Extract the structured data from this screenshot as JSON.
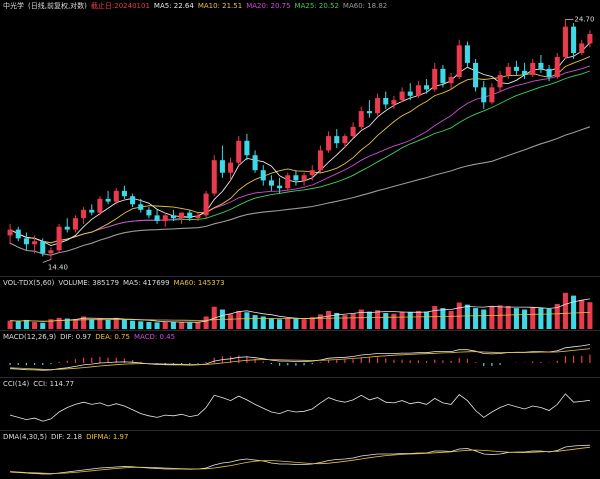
{
  "header": {
    "name": "中光学",
    "period": "(日线,前复权,对数)",
    "date_label": "截止日:20240101",
    "ma5": "MA5: 22.64",
    "ma10": "MA10: 21.51",
    "ma20": "MA20: 20.75",
    "ma25": "MA25: 20.52",
    "ma60": "MA60: 18.82"
  },
  "price_labels": {
    "high": "24.70",
    "low": "14.40"
  },
  "volume": {
    "title": "VOL-TDX(5,60)",
    "volume": "VOLUME: 385179",
    "ma5": "MA5: 417699",
    "ma60": "MA60: 145373"
  },
  "macd": {
    "title": "MACD(12,26,9)",
    "dif": "DIF: 0.97",
    "dea": "DEA: 0.75",
    "macd": "MACD: 0.45"
  },
  "cci": {
    "title": "CCI(14)",
    "cci": "CCI: 114.77"
  },
  "dma": {
    "title": "DMA(4,30,5)",
    "dif": "DIF: 2.18",
    "difma": "DIFMA: 1.97"
  },
  "colors": {
    "up": "#e83b4e",
    "down": "#3fd8e6",
    "ma5": "#e8e8e8",
    "ma10": "#e8c13a",
    "ma20": "#d04cd8",
    "ma25": "#3bd15a",
    "ma60": "#9a9a9a"
  },
  "chart_data": {
    "type": "candlestick",
    "ohlc": [
      [
        15.2,
        15.6,
        14.9,
        15.4
      ],
      [
        15.4,
        15.5,
        15.0,
        15.1
      ],
      [
        15.1,
        15.3,
        14.7,
        14.9
      ],
      [
        14.9,
        15.2,
        14.6,
        15.0
      ],
      [
        15.0,
        15.1,
        14.5,
        14.6
      ],
      [
        14.6,
        14.8,
        14.4,
        14.7
      ],
      [
        14.7,
        15.6,
        14.6,
        15.5
      ],
      [
        15.5,
        15.8,
        15.3,
        15.4
      ],
      [
        15.4,
        15.9,
        15.3,
        15.8
      ],
      [
        15.8,
        16.2,
        15.6,
        16.1
      ],
      [
        16.1,
        16.3,
        15.9,
        16.0
      ],
      [
        16.0,
        16.6,
        15.9,
        16.5
      ],
      [
        16.5,
        16.8,
        16.3,
        16.4
      ],
      [
        16.4,
        16.9,
        16.3,
        16.8
      ],
      [
        16.8,
        17.0,
        16.5,
        16.6
      ],
      [
        16.6,
        16.7,
        16.2,
        16.3
      ],
      [
        16.3,
        16.5,
        16.0,
        16.1
      ],
      [
        16.1,
        16.2,
        15.8,
        15.9
      ],
      [
        15.9,
        16.1,
        15.6,
        15.7
      ],
      [
        15.7,
        16.0,
        15.5,
        15.9
      ],
      [
        15.9,
        16.1,
        15.7,
        15.8
      ],
      [
        15.8,
        16.0,
        15.6,
        16.0
      ],
      [
        16.0,
        16.1,
        15.7,
        15.8
      ],
      [
        15.8,
        16.0,
        15.7,
        15.9
      ],
      [
        15.9,
        16.8,
        15.8,
        16.7
      ],
      [
        16.7,
        18.2,
        16.6,
        18.0
      ],
      [
        18.0,
        18.6,
        17.3,
        17.5
      ],
      [
        17.5,
        18.1,
        17.2,
        17.9
      ],
      [
        17.9,
        19.0,
        17.8,
        18.8
      ],
      [
        18.8,
        19.1,
        18.0,
        18.2
      ],
      [
        18.2,
        18.4,
        17.5,
        17.6
      ],
      [
        17.6,
        17.8,
        17.0,
        17.2
      ],
      [
        17.2,
        17.4,
        16.8,
        17.0
      ],
      [
        17.0,
        17.3,
        16.7,
        16.9
      ],
      [
        16.9,
        17.5,
        16.8,
        17.4
      ],
      [
        17.4,
        17.6,
        17.0,
        17.2
      ],
      [
        17.2,
        17.5,
        17.0,
        17.4
      ],
      [
        17.4,
        17.8,
        17.2,
        17.6
      ],
      [
        17.6,
        18.6,
        17.5,
        18.4
      ],
      [
        18.4,
        19.2,
        18.3,
        19.0
      ],
      [
        19.0,
        19.3,
        18.5,
        18.7
      ],
      [
        18.7,
        19.1,
        18.5,
        19.0
      ],
      [
        19.0,
        19.6,
        18.9,
        19.4
      ],
      [
        19.4,
        20.3,
        19.3,
        20.1
      ],
      [
        20.1,
        20.6,
        19.8,
        20.0
      ],
      [
        20.0,
        20.9,
        19.9,
        20.7
      ],
      [
        20.7,
        21.0,
        20.2,
        20.4
      ],
      [
        20.4,
        20.8,
        20.2,
        20.6
      ],
      [
        20.6,
        21.2,
        20.5,
        21.0
      ],
      [
        21.0,
        21.4,
        20.6,
        20.8
      ],
      [
        20.8,
        21.5,
        20.7,
        21.3
      ],
      [
        21.3,
        21.6,
        20.9,
        21.1
      ],
      [
        21.1,
        22.4,
        21.0,
        22.1
      ],
      [
        22.1,
        22.3,
        21.2,
        21.4
      ],
      [
        21.4,
        21.9,
        21.1,
        21.7
      ],
      [
        21.7,
        23.6,
        21.6,
        23.3
      ],
      [
        23.3,
        23.5,
        22.2,
        22.4
      ],
      [
        22.4,
        22.6,
        21.0,
        21.2
      ],
      [
        21.2,
        21.5,
        20.2,
        20.5
      ],
      [
        20.5,
        21.4,
        20.4,
        21.2
      ],
      [
        21.2,
        22.0,
        21.0,
        21.8
      ],
      [
        21.8,
        22.4,
        21.6,
        22.2
      ],
      [
        22.2,
        22.5,
        21.8,
        22.0
      ],
      [
        22.0,
        22.4,
        21.6,
        21.8
      ],
      [
        21.8,
        22.6,
        21.7,
        22.4
      ],
      [
        22.4,
        22.8,
        21.9,
        22.1
      ],
      [
        22.1,
        22.3,
        21.5,
        21.7
      ],
      [
        21.7,
        22.9,
        21.6,
        22.7
      ],
      [
        22.7,
        24.7,
        22.6,
        24.3
      ],
      [
        24.3,
        24.5,
        22.6,
        22.9
      ],
      [
        22.9,
        23.6,
        22.8,
        23.4
      ],
      [
        23.4,
        24.1,
        23.2,
        23.9
      ]
    ],
    "ylim": [
      14.0,
      25.0
    ],
    "volume": [
      120,
      110,
      130,
      100,
      90,
      140,
      160,
      150,
      145,
      180,
      140,
      150,
      130,
      160,
      140,
      120,
      110,
      100,
      95,
      105,
      100,
      95,
      90,
      100,
      180,
      320,
      280,
      210,
      260,
      240,
      200,
      180,
      150,
      140,
      160,
      150,
      140,
      170,
      210,
      260,
      230,
      200,
      220,
      280,
      250,
      270,
      230,
      220,
      250,
      240,
      260,
      250,
      330,
      300,
      260,
      380,
      350,
      300,
      280,
      320,
      340,
      330,
      300,
      280,
      310,
      300,
      290,
      360,
      520,
      480,
      420,
      385
    ],
    "macd_dif": [
      -0.3,
      -0.32,
      -0.35,
      -0.36,
      -0.38,
      -0.37,
      -0.3,
      -0.25,
      -0.18,
      -0.1,
      -0.06,
      0.0,
      0.02,
      0.05,
      0.06,
      0.04,
      0.0,
      -0.04,
      -0.08,
      -0.09,
      -0.1,
      -0.1,
      -0.11,
      -0.1,
      -0.05,
      0.1,
      0.18,
      0.22,
      0.3,
      0.32,
      0.28,
      0.22,
      0.15,
      0.1,
      0.1,
      0.08,
      0.08,
      0.1,
      0.16,
      0.25,
      0.28,
      0.3,
      0.34,
      0.42,
      0.45,
      0.5,
      0.5,
      0.5,
      0.52,
      0.52,
      0.54,
      0.54,
      0.6,
      0.6,
      0.6,
      0.7,
      0.7,
      0.62,
      0.5,
      0.48,
      0.5,
      0.55,
      0.56,
      0.56,
      0.6,
      0.6,
      0.58,
      0.64,
      0.8,
      0.85,
      0.9,
      0.97
    ],
    "macd_dea": [
      -0.25,
      -0.27,
      -0.29,
      -0.31,
      -0.33,
      -0.34,
      -0.33,
      -0.31,
      -0.28,
      -0.24,
      -0.2,
      -0.16,
      -0.12,
      -0.09,
      -0.06,
      -0.04,
      -0.03,
      -0.03,
      -0.04,
      -0.05,
      -0.06,
      -0.07,
      -0.08,
      -0.08,
      -0.08,
      -0.04,
      0.0,
      0.05,
      0.1,
      0.14,
      0.17,
      0.18,
      0.18,
      0.17,
      0.16,
      0.15,
      0.14,
      0.13,
      0.14,
      0.16,
      0.18,
      0.21,
      0.24,
      0.27,
      0.31,
      0.35,
      0.38,
      0.41,
      0.43,
      0.45,
      0.47,
      0.49,
      0.51,
      0.53,
      0.54,
      0.57,
      0.59,
      0.6,
      0.58,
      0.56,
      0.55,
      0.55,
      0.55,
      0.55,
      0.56,
      0.57,
      0.57,
      0.58,
      0.62,
      0.66,
      0.71,
      0.75
    ],
    "cci": [
      -80,
      -110,
      -140,
      -120,
      -160,
      -130,
      -40,
      20,
      60,
      90,
      60,
      80,
      40,
      70,
      40,
      -10,
      -60,
      -90,
      -110,
      -80,
      -90,
      -70,
      -100,
      -80,
      20,
      180,
      150,
      110,
      170,
      120,
      60,
      10,
      -40,
      -60,
      -20,
      -40,
      -30,
      0,
      80,
      150,
      110,
      90,
      120,
      180,
      120,
      150,
      90,
      80,
      110,
      70,
      90,
      60,
      140,
      80,
      60,
      190,
      110,
      -20,
      -110,
      -40,
      20,
      60,
      30,
      0,
      40,
      20,
      -20,
      60,
      200,
      90,
      100,
      115
    ],
    "cci_ylim": [
      -250,
      250
    ],
    "dma_dif": [
      -0.5,
      -0.55,
      -0.6,
      -0.65,
      -0.7,
      -0.7,
      -0.6,
      -0.5,
      -0.4,
      -0.3,
      -0.2,
      -0.1,
      -0.05,
      0.0,
      0.05,
      0.02,
      -0.05,
      -0.1,
      -0.15,
      -0.2,
      -0.2,
      -0.2,
      -0.22,
      -0.2,
      -0.1,
      0.2,
      0.4,
      0.5,
      0.7,
      0.8,
      0.7,
      0.6,
      0.4,
      0.3,
      0.3,
      0.25,
      0.25,
      0.3,
      0.45,
      0.65,
      0.75,
      0.8,
      0.9,
      1.1,
      1.2,
      1.3,
      1.3,
      1.3,
      1.35,
      1.35,
      1.4,
      1.4,
      1.6,
      1.6,
      1.55,
      1.8,
      1.85,
      1.6,
      1.3,
      1.25,
      1.3,
      1.45,
      1.5,
      1.5,
      1.6,
      1.6,
      1.5,
      1.65,
      2.0,
      2.1,
      2.15,
      2.18
    ],
    "dma_difma": [
      -0.45,
      -0.5,
      -0.55,
      -0.58,
      -0.62,
      -0.65,
      -0.64,
      -0.6,
      -0.54,
      -0.46,
      -0.38,
      -0.3,
      -0.22,
      -0.15,
      -0.08,
      -0.04,
      -0.03,
      -0.04,
      -0.07,
      -0.1,
      -0.14,
      -0.17,
      -0.19,
      -0.2,
      -0.18,
      -0.1,
      0.02,
      0.14,
      0.3,
      0.46,
      0.58,
      0.64,
      0.64,
      0.6,
      0.54,
      0.46,
      0.4,
      0.34,
      0.33,
      0.38,
      0.47,
      0.57,
      0.68,
      0.8,
      0.93,
      1.04,
      1.14,
      1.2,
      1.26,
      1.3,
      1.33,
      1.36,
      1.42,
      1.47,
      1.51,
      1.6,
      1.67,
      1.7,
      1.66,
      1.6,
      1.54,
      1.48,
      1.45,
      1.44,
      1.48,
      1.52,
      1.55,
      1.57,
      1.67,
      1.77,
      1.88,
      1.97
    ]
  }
}
